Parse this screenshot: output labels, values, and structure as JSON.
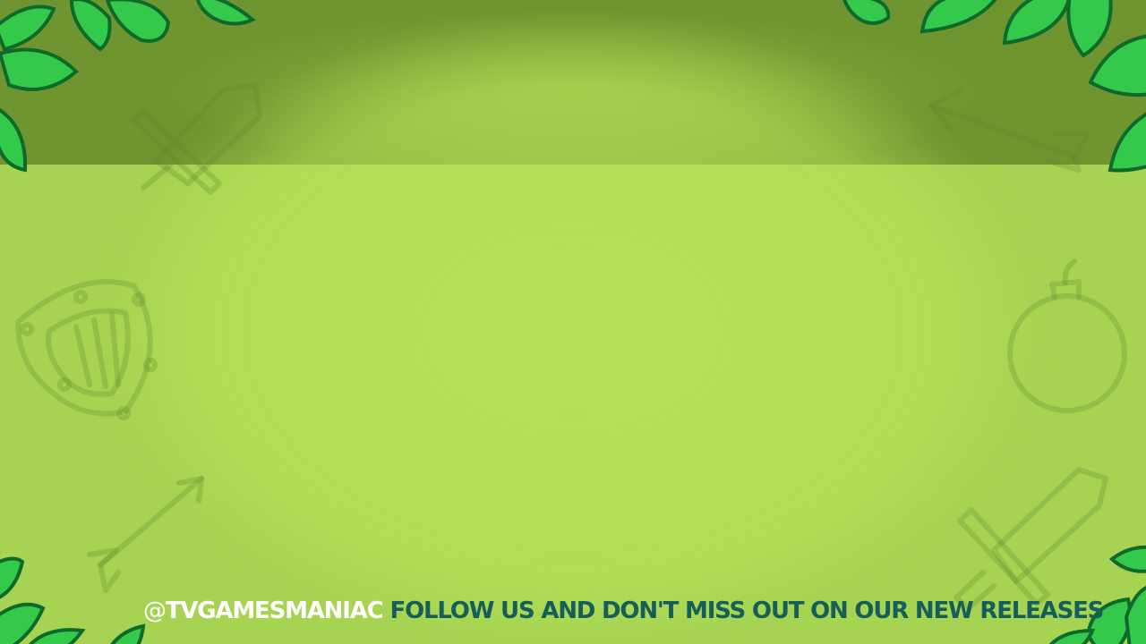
{
  "game_screen": {
    "colors": {
      "top_band": "#6f9530",
      "field": "#a6d452",
      "leaf_fill": "#34c94a",
      "leaf_outline": "#0e6a2a",
      "handle_text": "#ffffff",
      "slogan_text": "#155e5a"
    },
    "background_icons": [
      "sword-icon",
      "arrow-icon",
      "shield-icon",
      "bomb-icon",
      "arrow-icon",
      "sword-icon"
    ],
    "footer": {
      "at_sign": "@",
      "handle": "TVGAMESMANIAC",
      "slogan": "FOLLOW US AND DON'T MISS OUT ON OUR NEW RELEASES"
    }
  }
}
